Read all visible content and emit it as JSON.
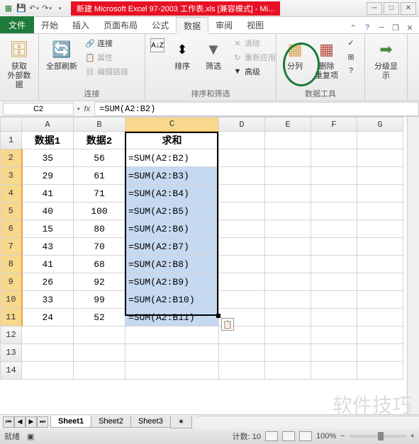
{
  "title": "新建 Microsoft Excel 97-2003 工作表.xls [兼容模式] - Mi...",
  "tabs": {
    "file": "文件",
    "start": "开始",
    "insert": "插入",
    "layout": "页面布局",
    "formula": "公式",
    "data": "数据",
    "review": "审阅",
    "view": "视图"
  },
  "ribbon": {
    "group_conn": "连接",
    "group_sort": "排序和筛选",
    "group_tools": "数据工具",
    "group_outline": "分级显示",
    "get_data": "获取\n外部数据",
    "refresh": "全部刷新",
    "conn": "连接",
    "prop": "属性",
    "edit_link": "编辑链接",
    "sort": "排序",
    "filter": "筛选",
    "clear": "清除",
    "reapply": "重新应用",
    "advanced": "高级",
    "text_cols": "分列",
    "remove_dup": "删除\n重复项",
    "outline": "分级显示"
  },
  "namebox": "C2",
  "formula": "=SUM(A2:B2)",
  "cols": [
    "A",
    "B",
    "C",
    "D",
    "E",
    "F",
    "G"
  ],
  "headers": {
    "a": "数据1",
    "b": "数据2",
    "c": "求和"
  },
  "rows": [
    {
      "n": 1
    },
    {
      "n": 2,
      "a": "35",
      "b": "56",
      "c": "=SUM(A2:B2)"
    },
    {
      "n": 3,
      "a": "29",
      "b": "61",
      "c": "=SUM(A2:B3)"
    },
    {
      "n": 4,
      "a": "41",
      "b": "71",
      "c": "=SUM(A2:B4)"
    },
    {
      "n": 5,
      "a": "40",
      "b": "100",
      "c": "=SUM(A2:B5)"
    },
    {
      "n": 6,
      "a": "15",
      "b": "80",
      "c": "=SUM(A2:B6)"
    },
    {
      "n": 7,
      "a": "43",
      "b": "70",
      "c": "=SUM(A2:B7)"
    },
    {
      "n": 8,
      "a": "41",
      "b": "68",
      "c": "=SUM(A2:B8)"
    },
    {
      "n": 9,
      "a": "26",
      "b": "92",
      "c": "=SUM(A2:B9)"
    },
    {
      "n": 10,
      "a": "33",
      "b": "99",
      "c": "=SUM(A2:B10)"
    },
    {
      "n": 11,
      "a": "24",
      "b": "52",
      "c": "=SUM(A2:B11)"
    },
    {
      "n": 12
    },
    {
      "n": 13
    },
    {
      "n": 14
    }
  ],
  "sheets": [
    "Sheet1",
    "Sheet2",
    "Sheet3"
  ],
  "status": {
    "ready": "就绪",
    "avg": "",
    "count": "计数: 10",
    "views": "",
    "zoom": "100%"
  },
  "watermark": "软件技巧",
  "chart_data": {
    "type": "table",
    "title": "求和",
    "columns": [
      "数据1",
      "数据2",
      "求和"
    ],
    "data": [
      [
        35,
        56,
        "=SUM(A2:B2)"
      ],
      [
        29,
        61,
        "=SUM(A2:B3)"
      ],
      [
        41,
        71,
        "=SUM(A2:B4)"
      ],
      [
        40,
        100,
        "=SUM(A2:B5)"
      ],
      [
        15,
        80,
        "=SUM(A2:B6)"
      ],
      [
        43,
        70,
        "=SUM(A2:B7)"
      ],
      [
        41,
        68,
        "=SUM(A2:B8)"
      ],
      [
        26,
        92,
        "=SUM(A2:B9)"
      ],
      [
        33,
        99,
        "=SUM(A2:B10)"
      ],
      [
        24,
        52,
        "=SUM(A2:B11)"
      ]
    ]
  }
}
